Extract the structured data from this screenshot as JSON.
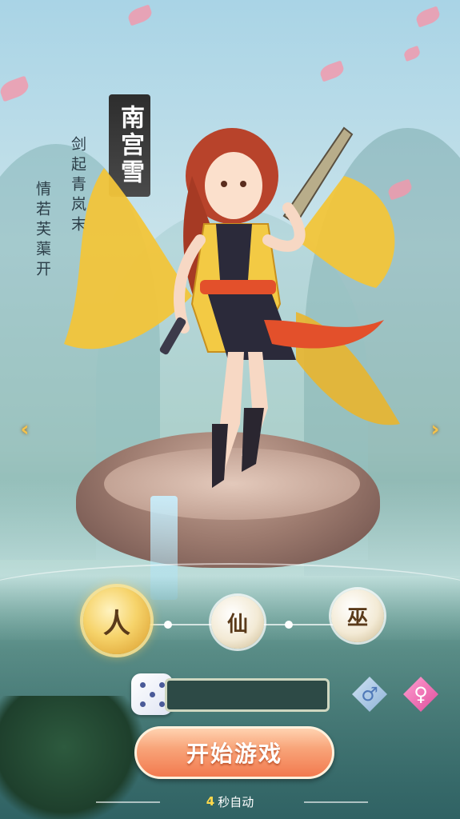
{
  "character": {
    "name": "南宫雪",
    "poem_line_1": "剑起青岚末",
    "poem_line_2": "情若芙蕖开"
  },
  "races": [
    {
      "label": "人",
      "selected": true
    },
    {
      "label": "仙",
      "selected": false
    },
    {
      "label": "巫",
      "selected": false
    }
  ],
  "name_input": {
    "value": "",
    "placeholder": ""
  },
  "gender": {
    "male_icon": "♂",
    "female_icon": "♀",
    "selected": "female"
  },
  "start_button": {
    "label": "开始游戏"
  },
  "auto_start": {
    "seconds": "4",
    "text": "秒自动"
  },
  "nav": {
    "prev_icon": "‹",
    "next_icon": "›"
  },
  "colors": {
    "accent_gold": "#f6d36a",
    "start_orange": "#f27a4f",
    "female_pink": "#e04d9c",
    "male_blue": "#4f79b8"
  }
}
